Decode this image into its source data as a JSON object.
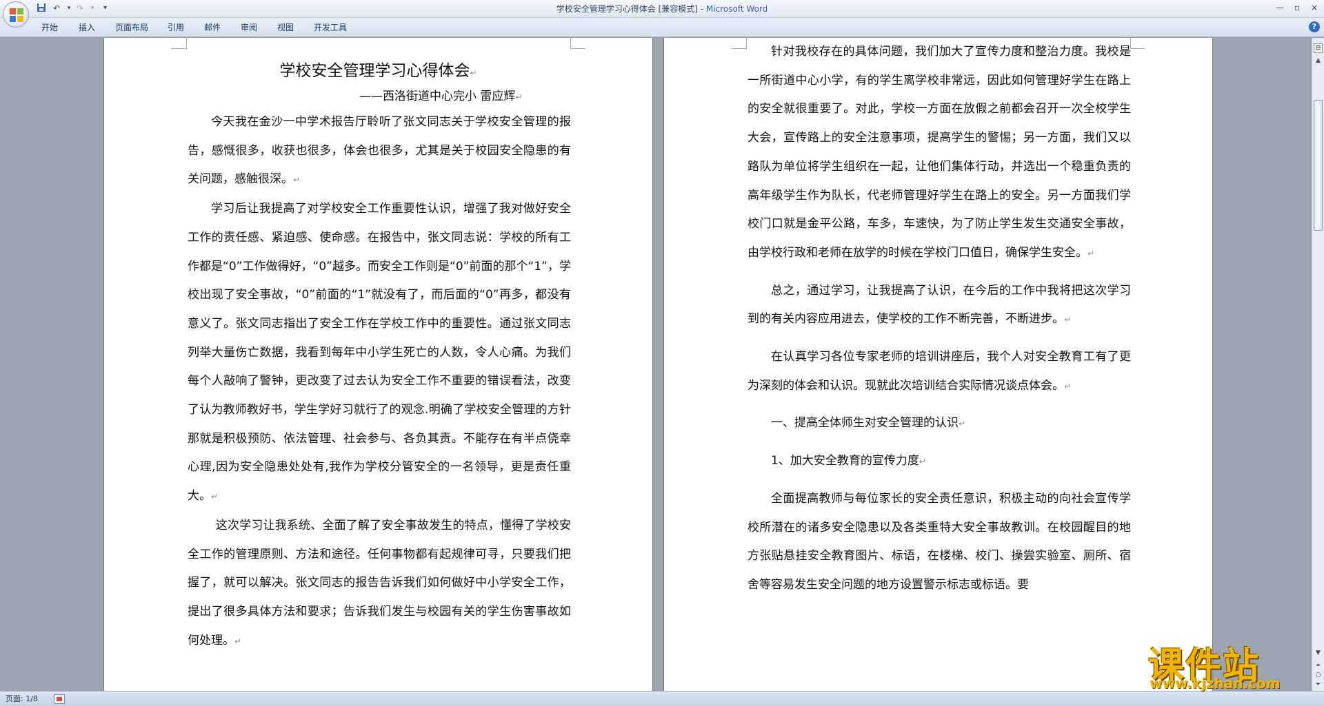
{
  "window": {
    "title_doc": "学校安全管理学习心得体会 [兼容模式] - ",
    "title_app": "Microsoft Word"
  },
  "quick_access": {
    "icons": [
      "save-icon",
      "undo-icon",
      "redo-icon",
      "customize-dropdown-icon"
    ]
  },
  "window_controls": {
    "minimize": "—",
    "restore": "▫",
    "close": "×"
  },
  "ribbon": {
    "tabs": [
      "开始",
      "插入",
      "页面布局",
      "引用",
      "邮件",
      "审阅",
      "视图",
      "开发工具"
    ],
    "help": "?"
  },
  "page_left": {
    "title": "学校安全管理学习心得体会",
    "author": "——西洛街道中心完小    雷应辉",
    "paragraphs": [
      "今天我在金沙一中学术报告厅聆听了张文同志关于学校安全管理的报告，感慨很多，收获也很多，体会也很多，尤其是关于校园安全隐患的有关问题，感触很深。",
      "学习后让我提高了对学校安全工作重要性认识，增强了我对做好安全工作的责任感、紧迫感、使命感。在报告中，张文同志说：学校的所有工作都是“0”工作做得好，“0”越多。而安全工作则是“0”前面的那个“1”，学校出现了安全事故，“0”前面的“1”就没有了，而后面的“0”再多，都没有意义了。张文同志指出了安全工作在学校工作中的重要性。通过张文同志列举大量伤亡数据，我看到每年中小学生死亡的人数，令人心痛。为我们每个人敲响了警钟，更改变了过去认为安全工作不重要的错误看法，改变了认为教师教好书，学生学好习就行了的观念.明确了学校安全管理的方针那就是积极预防、依法管理、社会参与、各负其责。不能存在有半点侥幸心理,因为安全隐患处处有,我作为学校分管安全的一名领导，更是责任重大。",
      "这次学习让我系统、全面了解了安全事故发生的特点，懂得了学校安全工作的管理原则、方法和途径。任何事物都有起规律可寻，只要我们把握了，就可以解决。张文同志的报告告诉我们如何做好中小学安全工作，提出了很多具体方法和要求；告诉我们发生与校园有关的学生伤害事故如何处理。"
    ]
  },
  "page_right": {
    "paragraphs": [
      "针对我校存在的具体问题，我们加大了宣传力度和整治力度。我校是一所街道中心小学，有的学生离学校非常远，因此如何管理好学生在路上的安全就很重要了。对此，学校一方面在放假之前都会召开一次全校学生大会，宣传路上的安全注意事项，提高学生的警惕；另一方面，我们又以路队为单位将学生组织在一起，让他们集体行动，并选出一个稳重负责的高年级学生作为队长，代老师管理好学生在路上的安全。另一方面我们学校门口就是金平公路，车多，车速快，为了防止学生发生交通安全事故，由学校行政和老师在放学的时候在学校门口值日，确保学生安全。",
      "总之，通过学习，让我提高了认识，在今后的工作中我将把这次学习到的有关内容应用进去，使学校的工作不断完善，不断进步。",
      "在认真学习各位专家老师的培训讲座后，我个人对安全教育工有了更为深刻的体会和认识。现就此次培训结合实际情况谈点体会。",
      "一、提高全体师生对安全管理的认识",
      "1、加大安全教育的宣传力度",
      "全面提高教师与每位家长的安全责任意识，积极主动的向社会宣传学校所潜在的诸多安全隐患以及各类重特大安全事故教训。在校园醒目的地方张贴悬挂安全教育图片、标语，在楼梯、校门、操尝实验室、厕所、宿舍等容易发生安全问题的地方设置警示标志或标语。要"
    ]
  },
  "paragraph_mark": "↵",
  "status": {
    "page": "页面: 1/8"
  },
  "watermark": {
    "text": "课件站",
    "url": "www.kjzhan.com"
  },
  "colors": {
    "accent": "#3b63a5",
    "watermark": "#f3b400"
  }
}
